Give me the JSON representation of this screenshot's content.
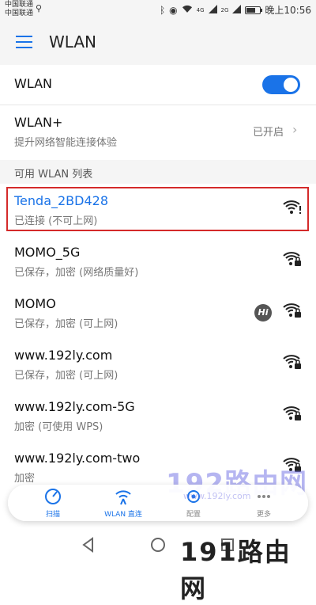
{
  "statusbar": {
    "carrier1": "中国联通",
    "carrier2": "中国联通",
    "signal_4g": "4G",
    "signal_2g": "2G",
    "time": "晚上10:56"
  },
  "header": {
    "title": "WLAN"
  },
  "wlan_toggle": {
    "label": "WLAN",
    "on": true
  },
  "wlan_plus": {
    "title": "WLAN+",
    "subtitle": "提升网络智能连接体验",
    "status": "已开启"
  },
  "section": {
    "title": "可用 WLAN 列表"
  },
  "networks": [
    {
      "name": "Tenda_2BD428",
      "status": "已连接 (不可上网)",
      "connected": true,
      "icon": "wifi-warning-icon"
    },
    {
      "name": "MOMO_5G",
      "status": "已保存，加密 (网络质量好)",
      "icon": "wifi-locked-icon"
    },
    {
      "name": "MOMO",
      "status": "已保存，加密 (可上网)",
      "icon": "wifi-locked-icon",
      "badge": "Hi"
    },
    {
      "name": "www.192ly.com",
      "status": "已保存，加密 (可上网)",
      "icon": "wifi-locked-icon"
    },
    {
      "name": "www.192ly.com-5G",
      "status": "加密 (可使用 WPS)",
      "icon": "wifi-locked-icon"
    },
    {
      "name": "www.192ly.com-two",
      "status": "加密",
      "icon": "wifi-locked-icon"
    }
  ],
  "actions": [
    {
      "label": "扫描",
      "icon": "scan-icon"
    },
    {
      "label": "WLAN 直连",
      "icon": "wifi-direct-icon"
    },
    {
      "label": "配置",
      "icon": "gear-icon"
    },
    {
      "label": "更多",
      "icon": "more-icon"
    }
  ],
  "watermark": {
    "top": "192路由网",
    "sub": "www.192ly.com",
    "bottom": "191路由网"
  },
  "colors": {
    "accent": "#1a73e8",
    "highlight": "#d42a2a"
  }
}
